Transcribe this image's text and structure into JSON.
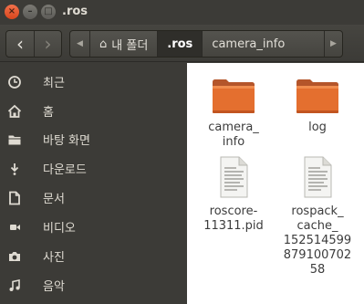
{
  "window": {
    "title": ".ros",
    "close_glyph": "×",
    "minimize_glyph": "–",
    "maximize_glyph": "□"
  },
  "toolbar": {
    "back_glyph": "‹",
    "forward_glyph": "›",
    "path_left_glyph": "◀",
    "path_right_glyph": "▶",
    "home_glyph": "⌂",
    "breadcrumbs": [
      {
        "label": "내 폴더",
        "icon": "home-icon"
      },
      {
        "label": ".ros",
        "active": true
      },
      {
        "label": "camera_info"
      }
    ]
  },
  "sidebar": {
    "items": [
      {
        "label": "최근",
        "icon": "clock-icon"
      },
      {
        "label": "홈",
        "icon": "home-icon"
      },
      {
        "label": "바탕 화면",
        "icon": "folder-icon"
      },
      {
        "label": "다운로드",
        "icon": "download-icon"
      },
      {
        "label": "문서",
        "icon": "document-icon"
      },
      {
        "label": "비디오",
        "icon": "video-icon"
      },
      {
        "label": "사진",
        "icon": "camera-icon"
      },
      {
        "label": "음악",
        "icon": "music-icon"
      }
    ]
  },
  "files": [
    {
      "name": "camera_\ninfo",
      "type": "folder"
    },
    {
      "name": "log",
      "type": "folder"
    },
    {
      "name": "roscore-\n11311.pid",
      "type": "text-file"
    },
    {
      "name": "rospack_\ncache_\n152514599\n879100702\n58",
      "type": "text-file"
    }
  ],
  "colors": {
    "folder": "#e46f2f",
    "folder_tab": "#f08c4e",
    "titlebar": "#3c3b37",
    "close": "#e95420"
  }
}
